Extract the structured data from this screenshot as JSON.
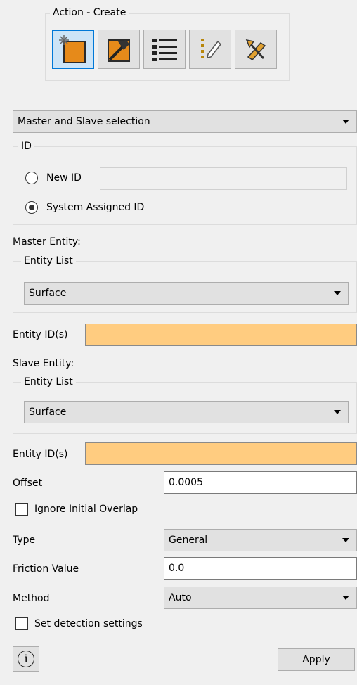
{
  "action_group": {
    "title": "Action - Create",
    "tools": [
      {
        "name": "create-icon",
        "active": true
      },
      {
        "name": "modify-icon",
        "active": false
      },
      {
        "name": "list-icon",
        "active": false
      },
      {
        "name": "edit-list-icon",
        "active": false
      },
      {
        "name": "delete-icon",
        "active": false
      }
    ]
  },
  "selection_mode": {
    "value": "Master and Slave selection"
  },
  "id_group": {
    "title": "ID",
    "new_id_label": "New ID",
    "new_id_value": "",
    "system_assigned_label": "System Assigned ID",
    "selected": "System Assigned ID"
  },
  "master": {
    "heading": "Master Entity:",
    "entity_list_title": "Entity List",
    "entity_type": "Surface",
    "entity_ids_label": "Entity ID(s)",
    "entity_ids_value": ""
  },
  "slave": {
    "heading": "Slave Entity:",
    "entity_list_title": "Entity List",
    "entity_type": "Surface",
    "entity_ids_label": "Entity ID(s)",
    "entity_ids_value": ""
  },
  "offset": {
    "label": "Offset",
    "value": "0.0005"
  },
  "ignore_overlap": {
    "label": "Ignore Initial Overlap",
    "checked": false
  },
  "type": {
    "label": "Type",
    "value": "General"
  },
  "friction": {
    "label": "Friction Value",
    "value": "0.0"
  },
  "method": {
    "label": "Method",
    "value": "Auto"
  },
  "detection": {
    "label": "Set detection settings",
    "checked": false
  },
  "footer": {
    "info_glyph": "i",
    "apply_label": "Apply"
  },
  "colors": {
    "required_field": "#ffcc80",
    "active_tool_border": "#0078d7",
    "active_tool_bg": "#cce4f7"
  }
}
